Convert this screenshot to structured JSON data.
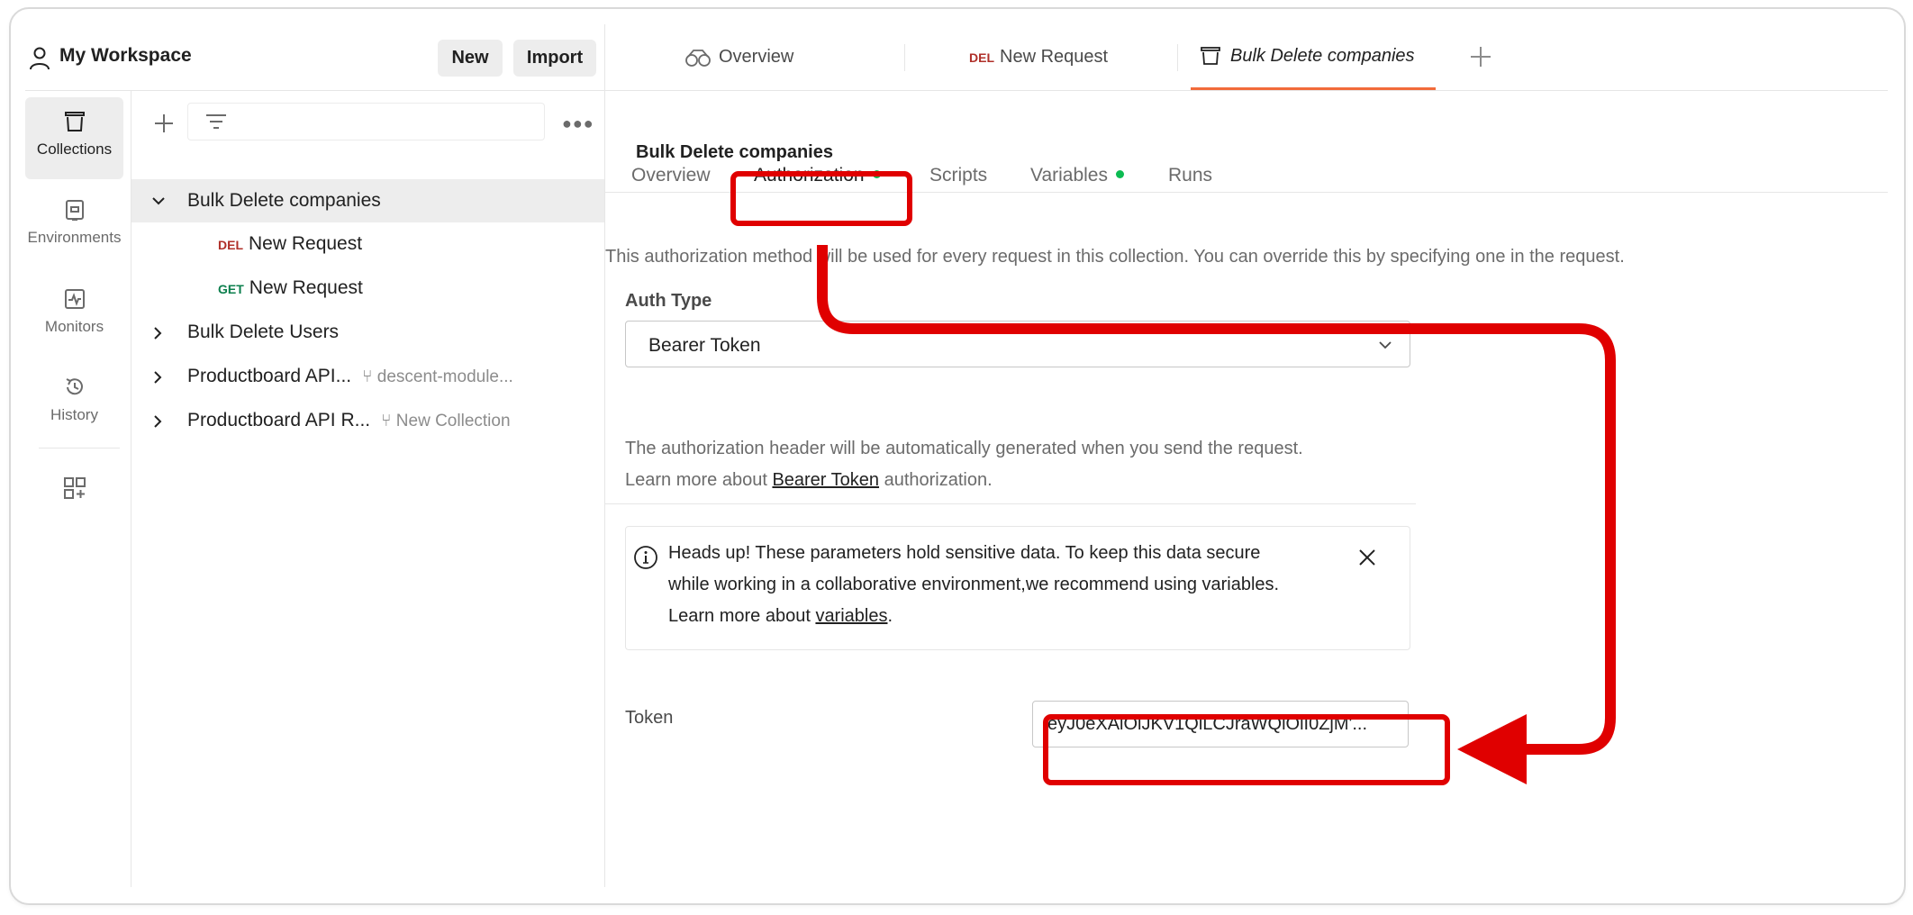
{
  "workspace": {
    "title": "My Workspace",
    "new_label": "New",
    "import_label": "Import"
  },
  "rail": {
    "items": [
      {
        "label": "Collections",
        "icon": "collections-icon"
      },
      {
        "label": "Environments",
        "icon": "environments-icon"
      },
      {
        "label": "Monitors",
        "icon": "monitors-icon"
      },
      {
        "label": "History",
        "icon": "history-icon"
      }
    ],
    "extra_icon": "add-widget-icon"
  },
  "sidebar": {
    "tree": [
      {
        "label": "Bulk Delete companies",
        "expanded": true,
        "selected": true
      },
      {
        "method": "DEL",
        "label": "New Request"
      },
      {
        "method": "GET",
        "label": "New Request"
      },
      {
        "label": "Bulk Delete Users",
        "expanded": false
      },
      {
        "label": "Productboard API...",
        "fork": "descent-module...",
        "expanded": false
      },
      {
        "label": "Productboard API R...",
        "fork": "New Collection",
        "expanded": false
      }
    ]
  },
  "tabs": [
    {
      "label": "Overview",
      "icon": "overview-icon"
    },
    {
      "method": "DEL",
      "label": "New Request"
    },
    {
      "label": "Bulk Delete companies",
      "icon": "collection-icon",
      "active": true
    }
  ],
  "collection": {
    "title": "Bulk Delete companies",
    "subtabs": [
      {
        "label": "Overview",
        "dot": false
      },
      {
        "label": "Authorization",
        "dot": true,
        "active": true
      },
      {
        "label": "Scripts",
        "dot": false
      },
      {
        "label": "Variables",
        "dot": true
      },
      {
        "label": "Runs",
        "dot": false
      }
    ]
  },
  "auth": {
    "description": "This authorization method will be used for every request in this collection. You can override this by specifying one in the request.",
    "type_label": "Auth Type",
    "type_value": "Bearer Token",
    "help_line1": "The authorization header will be automatically generated when you send the request.",
    "help_line2_pre": "Learn more about ",
    "help_line2_link": "Bearer Token",
    "help_line2_post": " authorization.",
    "alert_line1": "Heads up! These parameters hold sensitive data. To keep this data secure",
    "alert_line2": "while working in a collaborative environment,we recommend using variables.",
    "alert_line3_pre": "Learn more about ",
    "alert_line3_link": "variables",
    "alert_line3_post": ".",
    "token_label": "Token",
    "token_value": "eyJ0eXAiOiJKV1QiLCJraWQiOiI0ZjM'..."
  },
  "colors": {
    "annotation": "#e00000",
    "active_tab_underline": "#f26b3a",
    "status_dot": "#0cbb52",
    "method_del": "#b0302a",
    "method_get": "#0c7f4d"
  }
}
